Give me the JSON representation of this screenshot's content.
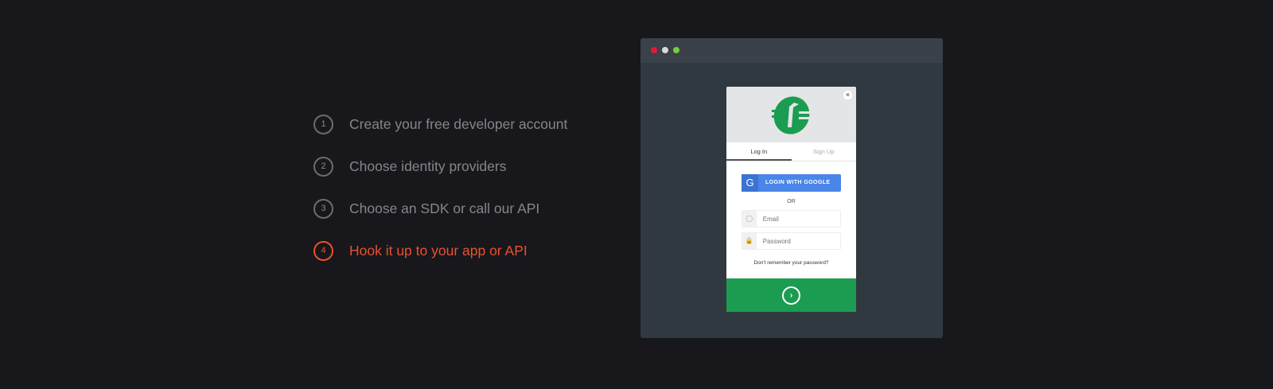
{
  "steps": [
    {
      "num": "1",
      "label": "Create your free developer account"
    },
    {
      "num": "2",
      "label": "Choose identity providers"
    },
    {
      "num": "3",
      "label": "Choose an SDK or call our API"
    },
    {
      "num": "4",
      "label": "Hook it up to your app or API"
    }
  ],
  "active_step": 4,
  "colors": {
    "accent": "#e8522f",
    "brand": "#1b9c51",
    "google": "#4a85e8"
  },
  "window": {
    "dots": [
      "#e8173a",
      "#d9d9d9",
      "#7ac943"
    ]
  },
  "login": {
    "close": "×",
    "tabs": [
      "Log In",
      "Sign Up"
    ],
    "google_label": "LOGIN WITH GOOGLE",
    "google_icon": "G",
    "or": "OR",
    "email_placeholder": "Email",
    "password_placeholder": "Password",
    "forgot": "Don't remember your password?",
    "submit_icon": "›"
  }
}
